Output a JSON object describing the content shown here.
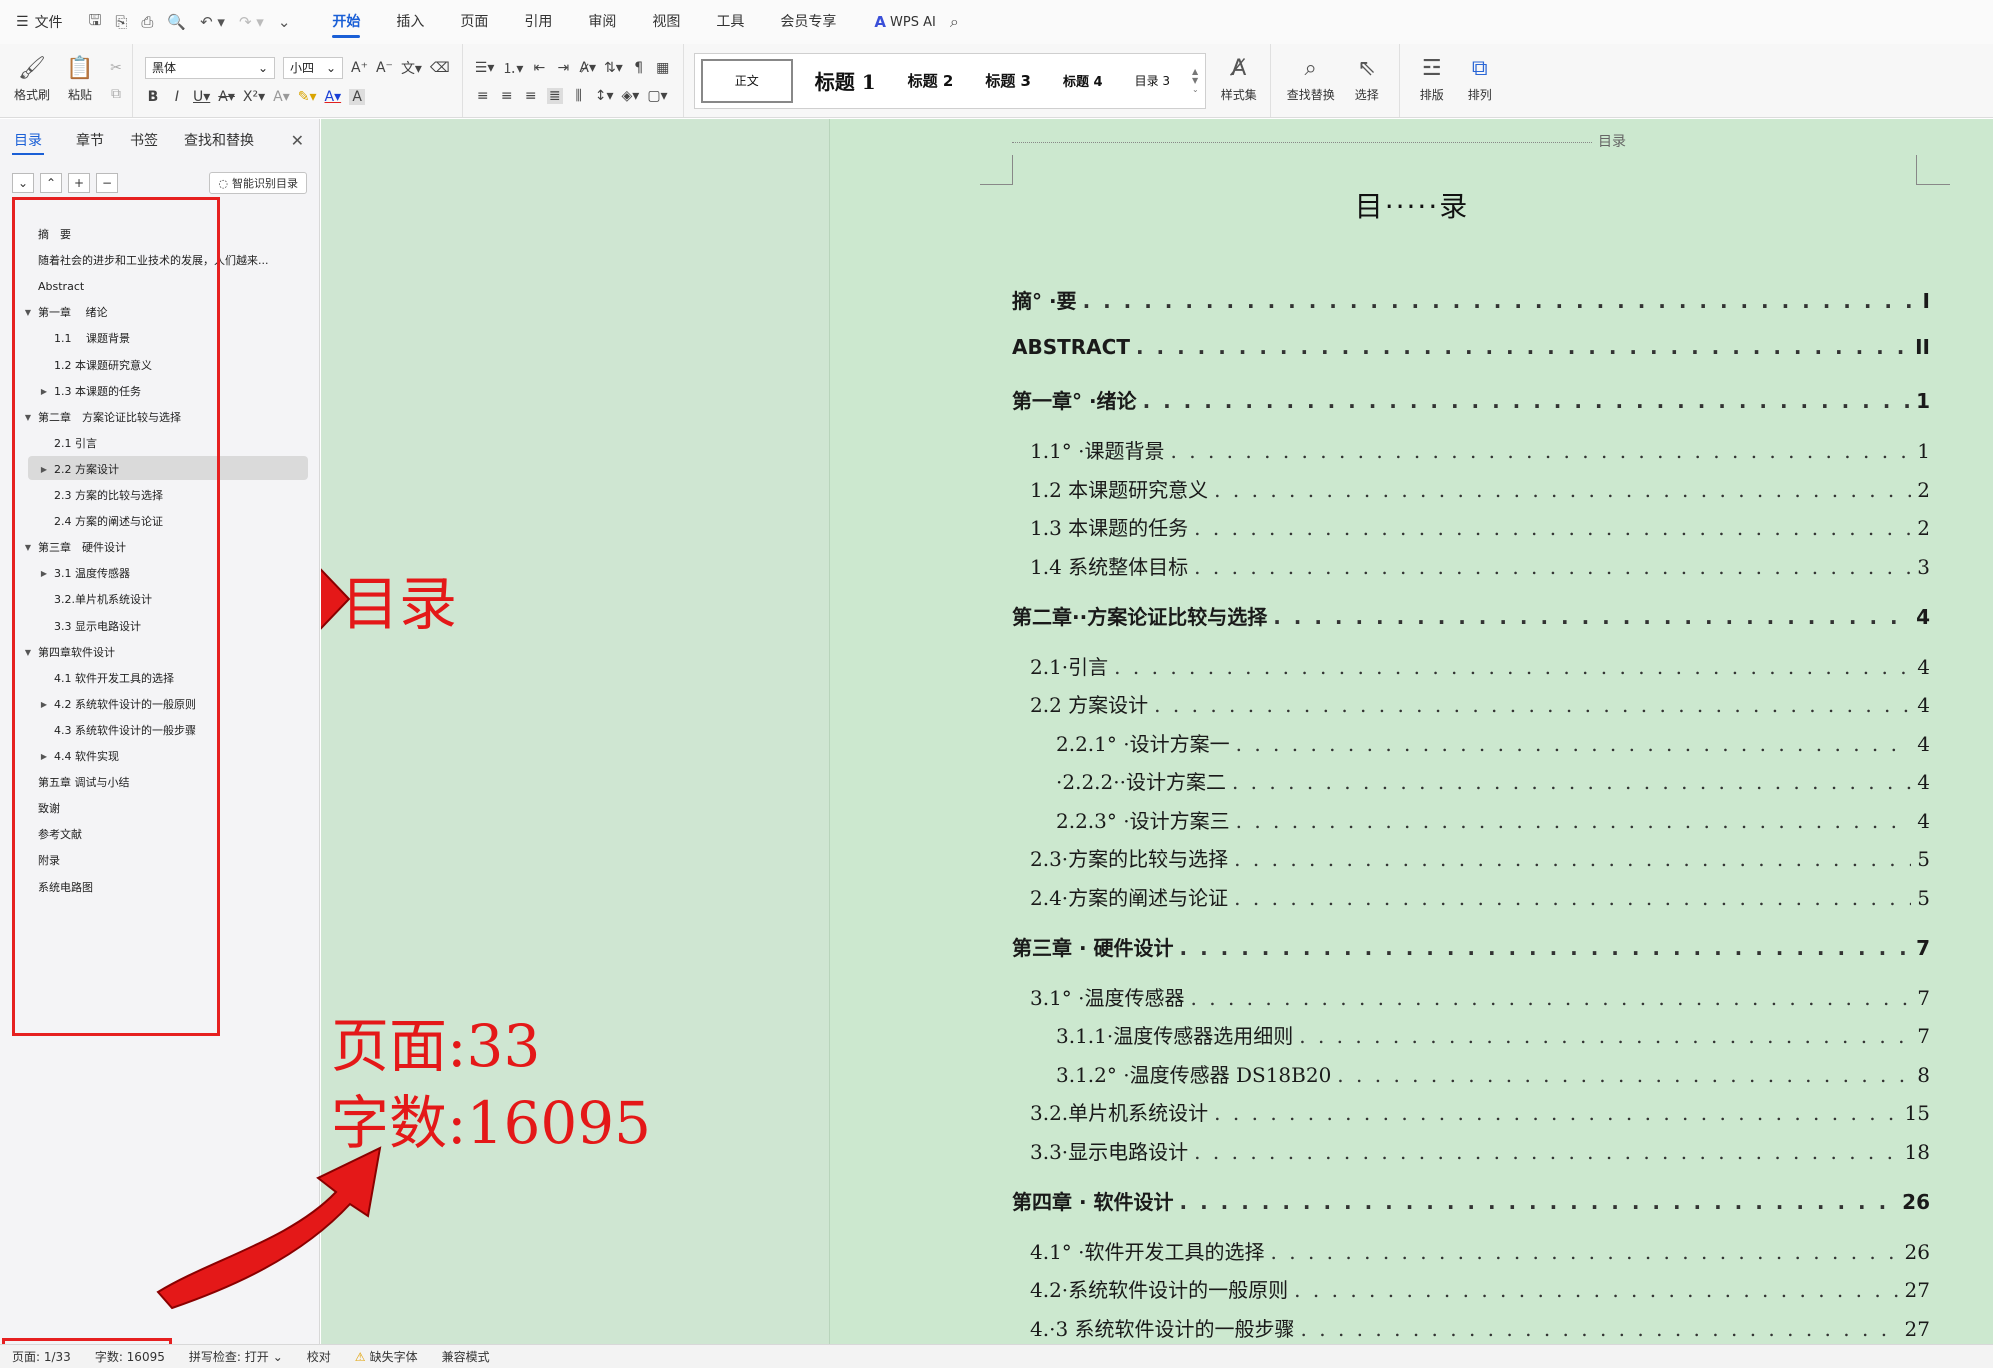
{
  "menubar": {
    "file_label": "文件",
    "tabs": [
      "开始",
      "插入",
      "页面",
      "引用",
      "审阅",
      "视图",
      "工具",
      "会员专享"
    ],
    "active_tab": "开始",
    "wps_ai": "WPS AI"
  },
  "ribbon": {
    "format_painter": "格式刷",
    "paste": "粘贴",
    "font_name": "黑体",
    "font_size": "小四",
    "styles": [
      "正文",
      "标题 1",
      "标题 2",
      "标题 3",
      "标题 4",
      "目录 3"
    ],
    "style_set": "样式集",
    "find_replace": "查找替换",
    "select": "选择",
    "layout": "排版",
    "arrange": "排列"
  },
  "nav": {
    "tabs": [
      "目录",
      "章节",
      "书签",
      "查找和替换"
    ],
    "smart_toc": "智能识别目录",
    "items": [
      {
        "label": "摘　要",
        "level": 1,
        "arrow": ""
      },
      {
        "label": "随着社会的进步和工业技术的发展，人们越来...",
        "level": 1,
        "arrow": ""
      },
      {
        "label": "Abstract",
        "level": 1,
        "arrow": ""
      },
      {
        "label": "第一章　 绪论",
        "level": 1,
        "arrow": "▼"
      },
      {
        "label": "1.1　 课题背景",
        "level": 2,
        "arrow": ""
      },
      {
        "label": "1.2 本课题研究意义",
        "level": 2,
        "arrow": ""
      },
      {
        "label": "1.3 本课题的任务",
        "level": 2,
        "arrow": "▶"
      },
      {
        "label": "第二章　方案论证比较与选择",
        "level": 1,
        "arrow": "▼"
      },
      {
        "label": "2.1  引言",
        "level": 2,
        "arrow": ""
      },
      {
        "label": "2.2 方案设计",
        "level": 2,
        "arrow": "▶"
      },
      {
        "label": "2.3  方案的比较与选择",
        "level": 2,
        "arrow": ""
      },
      {
        "label": "2.4  方案的阐述与论证",
        "level": 2,
        "arrow": ""
      },
      {
        "label": "第三章　硬件设计",
        "level": 1,
        "arrow": "▼"
      },
      {
        "label": "3.1  温度传感器",
        "level": 2,
        "arrow": "▶"
      },
      {
        "label": "3.2.单片机系统设计",
        "level": 2,
        "arrow": ""
      },
      {
        "label": "3.3  显示电路设计",
        "level": 2,
        "arrow": ""
      },
      {
        "label": "第四章软件设计",
        "level": 1,
        "arrow": "▼"
      },
      {
        "label": "4.1   软件开发工具的选择",
        "level": 2,
        "arrow": ""
      },
      {
        "label": "4.2  系统软件设计的一般原则",
        "level": 2,
        "arrow": "▶"
      },
      {
        "label": "4.3 系统软件设计的一般步骤",
        "level": 2,
        "arrow": ""
      },
      {
        "label": "4.4    软件实现",
        "level": 2,
        "arrow": "▶"
      },
      {
        "label": "第五章  调试与小结",
        "level": 1,
        "arrow": ""
      },
      {
        "label": "致谢",
        "level": 1,
        "arrow": ""
      },
      {
        "label": "参考文献",
        "level": 1,
        "arrow": ""
      },
      {
        "label": "附录",
        "level": 1,
        "arrow": ""
      },
      {
        "label": "系统电路图",
        "level": 1,
        "arrow": ""
      }
    ],
    "selected_index": 9
  },
  "document": {
    "header_text": "目录",
    "toc_title": "目·····录",
    "entries": [
      {
        "text": "摘° ·要",
        "page": "I",
        "level": 1
      },
      {
        "text": "ABSTRACT",
        "page": "II",
        "level": 1
      },
      {
        "text": "第一章° ·绪论",
        "page": "1",
        "level": 1
      },
      {
        "text": "1.1° ·课题背景",
        "page": "1",
        "level": 2
      },
      {
        "text": "1.2 本课题研究意义",
        "page": "2",
        "level": 2
      },
      {
        "text": "1.3 本课题的任务",
        "page": "2",
        "level": 2
      },
      {
        "text": "1.4 系统整体目标",
        "page": "3",
        "level": 2
      },
      {
        "text": "第二章··方案论证比较与选择",
        "page": "4",
        "level": 1
      },
      {
        "text": "2.1·引言",
        "page": "4",
        "level": 2
      },
      {
        "text": "2.2 方案设计",
        "page": "4",
        "level": 2
      },
      {
        "text": "2.2.1° ·设计方案一",
        "page": "4",
        "level": 3
      },
      {
        "text": "·2.2.2··设计方案二",
        "page": "4",
        "level": 3
      },
      {
        "text": "2.2.3° ·设计方案三",
        "page": "4",
        "level": 3
      },
      {
        "text": "2.3·方案的比较与选择",
        "page": "5",
        "level": 2
      },
      {
        "text": "2.4·方案的阐述与论证",
        "page": "5",
        "level": 2
      },
      {
        "text": "第三章 · 硬件设计",
        "page": "7",
        "level": 1
      },
      {
        "text": "3.1° ·温度传感器",
        "page": "7",
        "level": 2
      },
      {
        "text": "3.1.1·温度传感器选用细则",
        "page": "7",
        "level": 3
      },
      {
        "text": "3.1.2° ·温度传感器 DS18B20",
        "page": "8",
        "level": 3
      },
      {
        "text": "3.2.单片机系统设计",
        "page": "15",
        "level": 2
      },
      {
        "text": "3.3·显示电路设计",
        "page": "18",
        "level": 2
      },
      {
        "text": "第四章 · 软件设计",
        "page": "26",
        "level": 1
      },
      {
        "text": "4.1° ·软件开发工具的选择",
        "page": "26",
        "level": 2
      },
      {
        "text": "4.2·系统软件设计的一般原则",
        "page": "27",
        "level": 2
      },
      {
        "text": "4.·3 系统软件设计的一般步骤",
        "page": "27",
        "level": 2
      }
    ]
  },
  "annotations": {
    "toc_label": "目录",
    "pages_label": "页面:33",
    "words_label": "字数:16095",
    "color": "#e41818"
  },
  "status": {
    "page": "页面: 1/33",
    "words": "字数: 16095",
    "spell": "拼写检查: 打开",
    "proof": "校对",
    "missing_font": "缺失字体",
    "compat": "兼容模式"
  }
}
